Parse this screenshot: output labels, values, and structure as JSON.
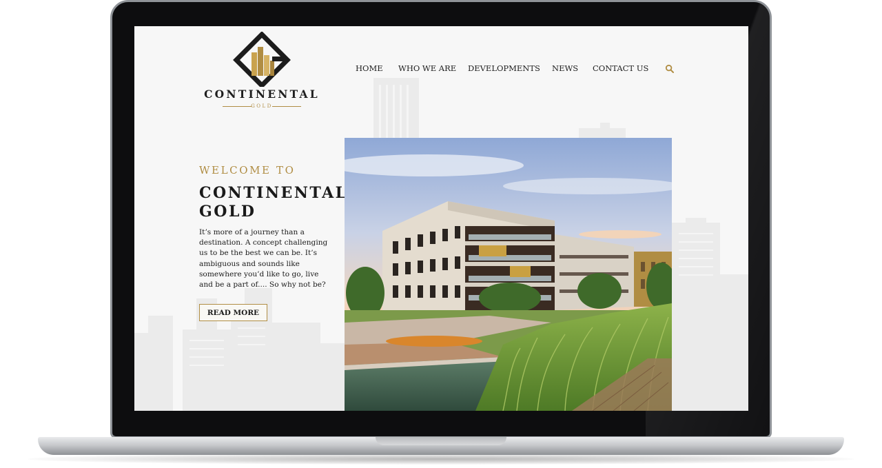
{
  "site": {
    "logo": {
      "name": "CONTINENTAL",
      "tagline": "GOLD"
    },
    "nav": [
      {
        "label": "HOME"
      },
      {
        "label": "WHO WE ARE"
      },
      {
        "label": "DEVELOPMENTS"
      },
      {
        "label": "NEWS"
      },
      {
        "label": "CONTACT US"
      }
    ],
    "search_icon": "search-icon"
  },
  "hero": {
    "eyebrow": "WELCOME TO",
    "title_line1": "CONTINENTAL",
    "title_line2": "GOLD",
    "body": "It’s more of a journey than a destination. A concept challenging us to be the best we can be. It’s ambiguous and sounds like somewhere you’d like to go, live and be a part of.... So why not be?",
    "cta_label": "READ MORE"
  },
  "colors": {
    "accent_gold": "#b08d43",
    "text_dark": "#1a1a1a",
    "page_bg": "#f7f7f7"
  }
}
